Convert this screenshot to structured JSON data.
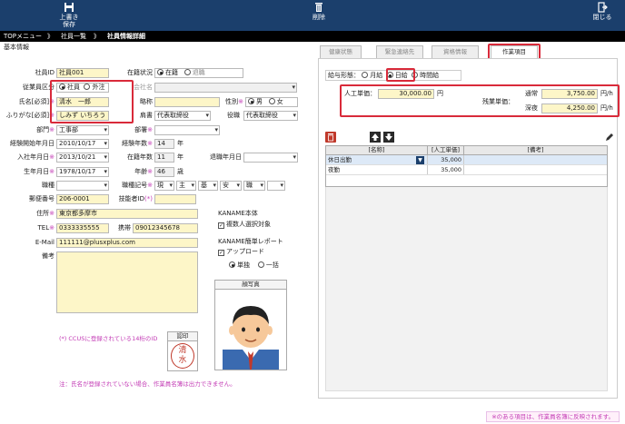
{
  "toolbar": {
    "save_label_1": "上書き",
    "save_label_2": "保存",
    "delete_label": "削除",
    "close_label": "閉じる"
  },
  "breadcrumb": {
    "item1": "TOPメニュー",
    "item2": "社員一覧",
    "item3": "社員情報詳細",
    "sep": "》"
  },
  "section_title": "基本情報",
  "form": {
    "employee_id_label": "社員ID",
    "employee_id": "社員001",
    "status_label": "在籍状況",
    "status_opt1": "在籍",
    "status_opt2": "退職",
    "category_label": "従業員区分",
    "category_opt1": "社員",
    "category_opt2": "外注",
    "company_label": "会社名",
    "name_label": "氏名[必須]",
    "name_req": "※",
    "name": "清水　一郎",
    "abbr_label": "略称",
    "gender_label": "性別",
    "gender_req": "※",
    "gender_opt1": "男",
    "gender_opt2": "女",
    "kana_label": "ふりがな[必須]",
    "kana_req": "※",
    "kana": "しみず いちろう",
    "title_label": "肩書",
    "title_value": "代表取締役",
    "position_label": "役職",
    "position_value": "代表取締役",
    "dept_label": "部門",
    "dept_req": "※",
    "dept_value": "工事部",
    "section_label": "部署",
    "section_req": "※",
    "exp_start_label": "経験開始年月日",
    "exp_start": "2010/10/17",
    "exp_years_label": "経験年数",
    "exp_years_req": "※",
    "exp_years": "14",
    "year_unit": "年",
    "join_label": "入社年月日",
    "join_req": "※",
    "join_date": "2013/10/21",
    "tenure_label": "在籍年数",
    "tenure": "11",
    "leave_label": "退職年月日",
    "birth_label": "生年月日",
    "birth_req": "※",
    "birth": "1978/10/17",
    "age_label": "年齢",
    "age_req": "※",
    "age": "46",
    "age_unit": "歳",
    "job_label": "職種",
    "jobcode_label": "職種記号",
    "jobcode_req": "※",
    "jobcode1": "現",
    "jobcode2": "主",
    "jobcode3": "基",
    "jobcode4": "安",
    "jobcode5": "職",
    "zip_label": "郵便番号",
    "zip": "206-0001",
    "tech_id_label": "技能者ID",
    "tech_id_req": "(*)",
    "addr_label": "住所",
    "addr_req": "※",
    "addr": "東京都多摩市",
    "tel_label": "TEL",
    "tel_req": "※",
    "tel": "0333335555",
    "mobile_label": "携帯",
    "mobile": "09012345678",
    "email_label": "E-Mail",
    "email": "111111@plusxplus.com",
    "note_label": "備考",
    "kaname_title": "KANAME本体",
    "kaname_chk": "複数人選択対象",
    "kaname_report_title": "KANAME簡単レポート",
    "upload_chk": "アップロード",
    "upload_opt1": "単独",
    "upload_opt2": "一括",
    "photo_title": "顔写真",
    "seal_title": "認印",
    "seal_text1": "清",
    "seal_text2": "水",
    "ccus_note": "(*) CCUSに登録されている14桁のID",
    "bottom_note_left": "注：氏名が登録されていない場合、作業員名簿は出力できません。"
  },
  "tabs": [
    {
      "label": "健康状態"
    },
    {
      "label": "緊急連絡先"
    },
    {
      "label": "資格情報"
    },
    {
      "label": "作業項目"
    }
  ],
  "pay": {
    "form_label": "給与形態：",
    "opt1": "月給",
    "opt2": "日給",
    "opt3": "時間給",
    "unit_price_label": "人工単価：",
    "unit_price": "30,000.00",
    "yen": "円",
    "overtime_label": "残業単価：",
    "normal_label": "通常",
    "normal_value": "3,750.00",
    "night_label": "深夜",
    "night_value": "4,250.00",
    "per_hour": "円/h"
  },
  "table": {
    "headers": [
      "[名称]",
      "[人工単価]",
      "[備考]"
    ],
    "rows": [
      {
        "name": "休日出勤",
        "price": "35,000",
        "note": ""
      },
      {
        "name": "夜勤",
        "price": "35,000",
        "note": ""
      }
    ]
  },
  "bottom_note": "※のある項目は、作業員名簿に反映されます。",
  "colors": {
    "topbar": "#1b3f6c",
    "highlight": "#d92a3a",
    "required": "#c33bb5",
    "field": "#fdf6c8"
  }
}
